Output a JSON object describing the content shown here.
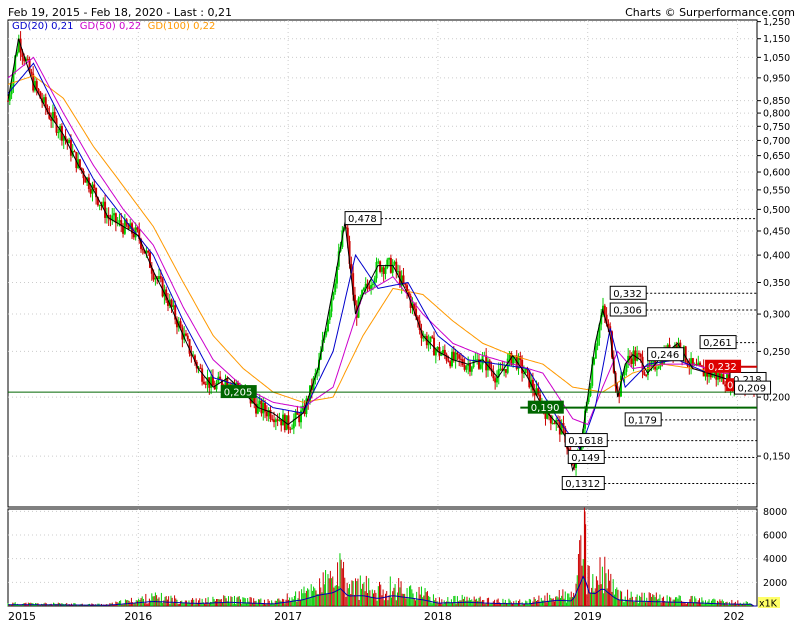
{
  "header": {
    "range": "Feb 19, 2015 - Feb 18, 2020 - Last : 0,21",
    "credit": "Charts © Surperformance.com"
  },
  "legend": [
    {
      "label": "GD(20)",
      "value": "0,21",
      "color": "#0000cc"
    },
    {
      "label": "GD(50)",
      "value": "0,22",
      "color": "#cc00cc"
    },
    {
      "label": "GD(100)",
      "value": "0,22",
      "color": "#ff9900"
    }
  ],
  "colors": {
    "up": "#00cc00",
    "down": "#cc0000",
    "price_line": "#000000",
    "gd20": "#0000cc",
    "gd50": "#cc00cc",
    "gd100": "#ff9900",
    "volume_up": "#00cc00",
    "volume_down": "#cc0000",
    "vol_avg": "#0000aa",
    "support": "#006600",
    "resistance": "#cc0000"
  },
  "chart_data": {
    "type": "line",
    "log_scale": true,
    "y_ticks": [
      "1,250",
      "1,150",
      "1,050",
      "0,950",
      "0,850",
      "0,800",
      "0,750",
      "0,700",
      "0,650",
      "0,600",
      "0,550",
      "0,500",
      "0,450",
      "0,400",
      "0,350",
      "0,300",
      "0,250",
      "0,200",
      "0,150"
    ],
    "y_tick_values": [
      1.25,
      1.15,
      1.05,
      0.95,
      0.85,
      0.8,
      0.75,
      0.7,
      0.65,
      0.6,
      0.55,
      0.5,
      0.45,
      0.4,
      0.35,
      0.3,
      0.25,
      0.2,
      0.15
    ],
    "ylim": [
      0.117,
      1.26
    ],
    "x_labels": [
      "2015",
      "2016",
      "2017",
      "2018",
      "2019",
      "202"
    ],
    "price": {
      "x": [
        2015.13,
        2015.2,
        2015.3,
        2015.4,
        2015.5,
        2015.6,
        2015.7,
        2015.8,
        2015.9,
        2016.0,
        2016.1,
        2016.2,
        2016.3,
        2016.4,
        2016.5,
        2016.6,
        2016.7,
        2016.8,
        2016.9,
        2017.0,
        2017.1,
        2017.2,
        2017.3,
        2017.38,
        2017.45,
        2017.5,
        2017.6,
        2017.7,
        2017.8,
        2017.9,
        2018.0,
        2018.1,
        2018.2,
        2018.3,
        2018.4,
        2018.5,
        2018.6,
        2018.7,
        2018.8,
        2018.85,
        2018.9,
        2018.95,
        2019.0,
        2019.05,
        2019.1,
        2019.15,
        2019.2,
        2019.25,
        2019.3,
        2019.35,
        2019.4,
        2019.5,
        2019.6,
        2019.7,
        2019.8,
        2019.9,
        2020.0,
        2020.13
      ],
      "y": [
        0.85,
        1.15,
        0.92,
        0.8,
        0.72,
        0.62,
        0.55,
        0.48,
        0.46,
        0.44,
        0.37,
        0.32,
        0.27,
        0.23,
        0.21,
        0.22,
        0.205,
        0.19,
        0.185,
        0.175,
        0.185,
        0.23,
        0.34,
        0.47,
        0.3,
        0.33,
        0.38,
        0.38,
        0.33,
        0.27,
        0.25,
        0.24,
        0.235,
        0.24,
        0.22,
        0.245,
        0.22,
        0.19,
        0.175,
        0.165,
        0.14,
        0.155,
        0.2,
        0.26,
        0.306,
        0.27,
        0.2,
        0.235,
        0.246,
        0.24,
        0.225,
        0.245,
        0.26,
        0.23,
        0.225,
        0.22,
        0.215,
        0.21
      ]
    },
    "gd20": {
      "x": [
        2015.13,
        2015.3,
        2015.5,
        2015.7,
        2015.9,
        2016.1,
        2016.3,
        2016.5,
        2016.7,
        2016.9,
        2017.1,
        2017.3,
        2017.45,
        2017.6,
        2017.8,
        2018.0,
        2018.2,
        2018.4,
        2018.6,
        2018.8,
        2018.95,
        2019.05,
        2019.15,
        2019.25,
        2019.4,
        2019.6,
        2019.8,
        2020.0,
        2020.13
      ],
      "y": [
        0.88,
        1.02,
        0.76,
        0.58,
        0.48,
        0.4,
        0.29,
        0.22,
        0.21,
        0.19,
        0.185,
        0.25,
        0.4,
        0.34,
        0.35,
        0.27,
        0.24,
        0.235,
        0.23,
        0.18,
        0.155,
        0.19,
        0.28,
        0.21,
        0.235,
        0.24,
        0.225,
        0.215,
        0.21
      ]
    },
    "gd50": {
      "x": [
        2015.13,
        2015.3,
        2015.5,
        2015.7,
        2015.9,
        2016.1,
        2016.3,
        2016.5,
        2016.7,
        2016.9,
        2017.1,
        2017.3,
        2017.5,
        2017.7,
        2017.9,
        2018.1,
        2018.3,
        2018.5,
        2018.7,
        2018.9,
        2019.0,
        2019.1,
        2019.2,
        2019.3,
        2019.5,
        2019.7,
        2019.9,
        2020.13
      ],
      "y": [
        0.95,
        1.05,
        0.8,
        0.62,
        0.5,
        0.42,
        0.31,
        0.24,
        0.21,
        0.195,
        0.19,
        0.21,
        0.33,
        0.36,
        0.3,
        0.26,
        0.245,
        0.235,
        0.225,
        0.18,
        0.175,
        0.21,
        0.25,
        0.23,
        0.235,
        0.235,
        0.225,
        0.22
      ]
    },
    "gd100": {
      "x": [
        2015.13,
        2015.3,
        2015.5,
        2015.7,
        2015.9,
        2016.1,
        2016.3,
        2016.5,
        2016.7,
        2016.9,
        2017.1,
        2017.3,
        2017.5,
        2017.7,
        2017.9,
        2018.1,
        2018.3,
        2018.5,
        2018.7,
        2018.9,
        2019.1,
        2019.3,
        2019.5,
        2019.7,
        2019.9,
        2020.13
      ],
      "y": [
        0.92,
        0.96,
        0.86,
        0.68,
        0.56,
        0.46,
        0.35,
        0.27,
        0.23,
        0.205,
        0.195,
        0.2,
        0.27,
        0.34,
        0.33,
        0.29,
        0.26,
        0.245,
        0.235,
        0.21,
        0.205,
        0.225,
        0.235,
        0.23,
        0.225,
        0.22
      ]
    },
    "annotations": [
      {
        "text": "0,478",
        "x": 2017.38,
        "y": 0.478,
        "line": true
      },
      {
        "text": "0,332",
        "x": 2019.15,
        "y": 0.332,
        "line": true
      },
      {
        "text": "0,306",
        "x": 2019.15,
        "y": 0.306,
        "line": true
      },
      {
        "text": "0,261",
        "x": 2019.75,
        "y": 0.261,
        "line": true
      },
      {
        "text": "0,246",
        "x": 2019.4,
        "y": 0.246,
        "line": false
      },
      {
        "text": "0,218",
        "x": 2019.95,
        "y": 0.218,
        "line": false
      },
      {
        "text": "0,209",
        "x": 2019.98,
        "y": 0.209,
        "line": false
      },
      {
        "text": "0,179",
        "x": 2019.25,
        "y": 0.179,
        "line": true
      },
      {
        "text": "0,1618",
        "x": 2018.85,
        "y": 0.1618,
        "line": true
      },
      {
        "text": "0,149",
        "x": 2018.87,
        "y": 0.149,
        "line": true
      },
      {
        "text": "0,1312",
        "x": 2018.83,
        "y": 0.1312,
        "line": true
      }
    ],
    "support_labels": [
      {
        "text": "0,205",
        "x": 2016.55,
        "y": 0.205,
        "color": "#006600"
      },
      {
        "text": "0,190",
        "x": 2018.6,
        "y": 0.19,
        "color": "#006600"
      }
    ],
    "resistance_labels": [
      {
        "text": "0,232",
        "x": 2019.85,
        "y": 0.232,
        "color": "#dd0000"
      }
    ],
    "small_labels": [
      {
        "text": "0",
        "x": 2019.95,
        "y": 0.212,
        "color": "#dd0000"
      }
    ],
    "volume": {
      "y_ticks": [
        "8000",
        "6000",
        "4000",
        "2000"
      ],
      "y_tick_values": [
        8000,
        6000,
        4000,
        2000
      ],
      "ylim": [
        0,
        8200
      ],
      "unit_label": "x1K",
      "x": [
        2015.2,
        2015.5,
        2015.8,
        2016.1,
        2016.4,
        2016.6,
        2016.9,
        2017.1,
        2017.2,
        2017.3,
        2017.35,
        2017.4,
        2017.5,
        2017.6,
        2017.7,
        2017.8,
        2017.9,
        2018.0,
        2018.2,
        2018.4,
        2018.6,
        2018.8,
        2018.9,
        2018.98,
        2019.0,
        2019.05,
        2019.1,
        2019.15,
        2019.2,
        2019.3,
        2019.5,
        2019.7,
        2019.9,
        2020.1
      ],
      "values": [
        300,
        250,
        200,
        1100,
        600,
        900,
        500,
        1500,
        2600,
        3200,
        4200,
        2400,
        2500,
        1800,
        2500,
        2000,
        1500,
        700,
        900,
        600,
        500,
        1400,
        1200,
        8000,
        3200,
        3000,
        4300,
        2800,
        1500,
        1200,
        1000,
        800,
        500,
        400
      ]
    }
  }
}
